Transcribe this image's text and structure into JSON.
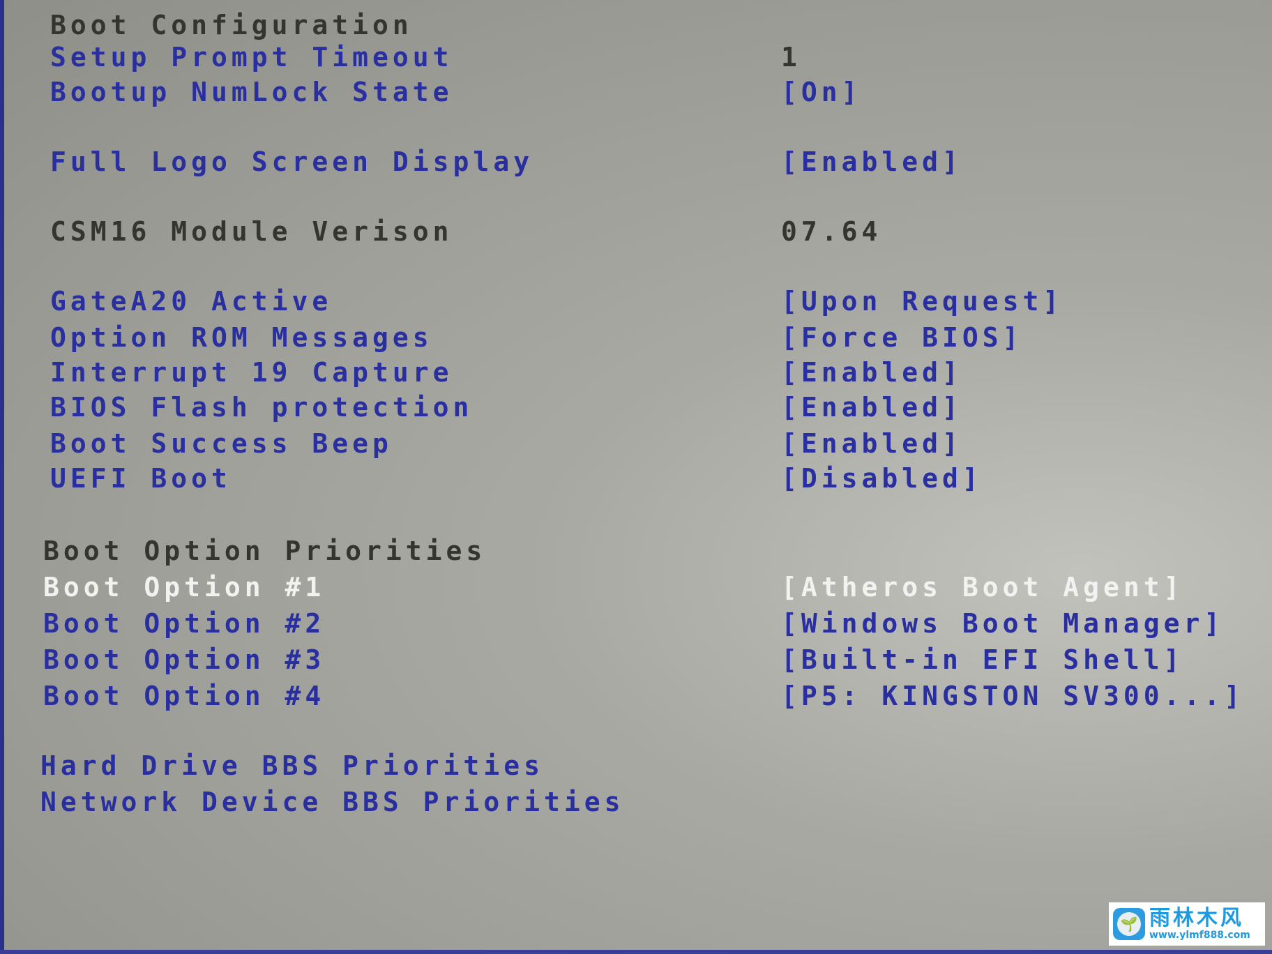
{
  "section_title": "Boot Configuration",
  "settings": [
    {
      "label": "Setup Prompt Timeout",
      "value": "1"
    },
    {
      "label": "Bootup NumLock State",
      "value": "[On]"
    },
    {
      "label": "Full Logo Screen Display",
      "value": "[Enabled]"
    },
    {
      "label": "CSM16 Module Verison",
      "value": "07.64"
    },
    {
      "label": "GateA20 Active",
      "value": "[Upon Request]"
    },
    {
      "label": "Option ROM Messages",
      "value": "[Force BIOS]"
    },
    {
      "label": "Interrupt 19 Capture",
      "value": "[Enabled]"
    },
    {
      "label": "BIOS Flash protection",
      "value": "[Enabled]"
    },
    {
      "label": "Boot Success Beep",
      "value": "[Enabled]"
    },
    {
      "label": "UEFI Boot",
      "value": "[Disabled]"
    }
  ],
  "boot_priorities": {
    "title": "Boot Option Priorities",
    "options": [
      {
        "label": "Boot Option #1",
        "value": "[Atheros Boot Agent]"
      },
      {
        "label": "Boot Option #2",
        "value": "[Windows Boot Manager]"
      },
      {
        "label": "Boot Option #3",
        "value": "[Built-in EFI Shell]"
      },
      {
        "label": "Boot Option #4",
        "value": "[P5: KINGSTON SV300...]"
      }
    ]
  },
  "submenus": [
    {
      "label": "Hard Drive BBS Priorities"
    },
    {
      "label": "Network Device BBS Priorities"
    }
  ],
  "watermark": {
    "title": "雨林木风",
    "url": "www.ylmf888.com",
    "icon": "sprout-icon"
  },
  "colors": {
    "background": "#a9a9a3",
    "selectable_text": "#2a2fa0",
    "static_text": "#35352f",
    "highlighted_text": "#f2f2f0"
  }
}
